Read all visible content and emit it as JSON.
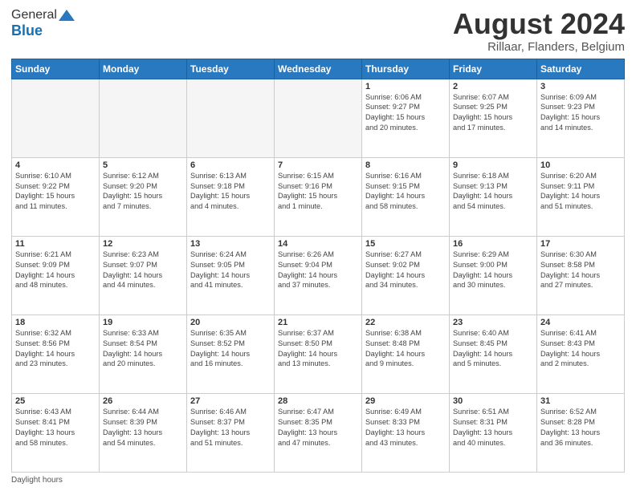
{
  "header": {
    "logo_general": "General",
    "logo_blue": "Blue",
    "month_title": "August 2024",
    "location": "Rillaar, Flanders, Belgium"
  },
  "days_of_week": [
    "Sunday",
    "Monday",
    "Tuesday",
    "Wednesday",
    "Thursday",
    "Friday",
    "Saturday"
  ],
  "footer": {
    "daylight_label": "Daylight hours"
  },
  "weeks": [
    [
      {
        "day": "",
        "info": ""
      },
      {
        "day": "",
        "info": ""
      },
      {
        "day": "",
        "info": ""
      },
      {
        "day": "",
        "info": ""
      },
      {
        "day": "1",
        "info": "Sunrise: 6:06 AM\nSunset: 9:27 PM\nDaylight: 15 hours\nand 20 minutes."
      },
      {
        "day": "2",
        "info": "Sunrise: 6:07 AM\nSunset: 9:25 PM\nDaylight: 15 hours\nand 17 minutes."
      },
      {
        "day": "3",
        "info": "Sunrise: 6:09 AM\nSunset: 9:23 PM\nDaylight: 15 hours\nand 14 minutes."
      }
    ],
    [
      {
        "day": "4",
        "info": "Sunrise: 6:10 AM\nSunset: 9:22 PM\nDaylight: 15 hours\nand 11 minutes."
      },
      {
        "day": "5",
        "info": "Sunrise: 6:12 AM\nSunset: 9:20 PM\nDaylight: 15 hours\nand 7 minutes."
      },
      {
        "day": "6",
        "info": "Sunrise: 6:13 AM\nSunset: 9:18 PM\nDaylight: 15 hours\nand 4 minutes."
      },
      {
        "day": "7",
        "info": "Sunrise: 6:15 AM\nSunset: 9:16 PM\nDaylight: 15 hours\nand 1 minute."
      },
      {
        "day": "8",
        "info": "Sunrise: 6:16 AM\nSunset: 9:15 PM\nDaylight: 14 hours\nand 58 minutes."
      },
      {
        "day": "9",
        "info": "Sunrise: 6:18 AM\nSunset: 9:13 PM\nDaylight: 14 hours\nand 54 minutes."
      },
      {
        "day": "10",
        "info": "Sunrise: 6:20 AM\nSunset: 9:11 PM\nDaylight: 14 hours\nand 51 minutes."
      }
    ],
    [
      {
        "day": "11",
        "info": "Sunrise: 6:21 AM\nSunset: 9:09 PM\nDaylight: 14 hours\nand 48 minutes."
      },
      {
        "day": "12",
        "info": "Sunrise: 6:23 AM\nSunset: 9:07 PM\nDaylight: 14 hours\nand 44 minutes."
      },
      {
        "day": "13",
        "info": "Sunrise: 6:24 AM\nSunset: 9:05 PM\nDaylight: 14 hours\nand 41 minutes."
      },
      {
        "day": "14",
        "info": "Sunrise: 6:26 AM\nSunset: 9:04 PM\nDaylight: 14 hours\nand 37 minutes."
      },
      {
        "day": "15",
        "info": "Sunrise: 6:27 AM\nSunset: 9:02 PM\nDaylight: 14 hours\nand 34 minutes."
      },
      {
        "day": "16",
        "info": "Sunrise: 6:29 AM\nSunset: 9:00 PM\nDaylight: 14 hours\nand 30 minutes."
      },
      {
        "day": "17",
        "info": "Sunrise: 6:30 AM\nSunset: 8:58 PM\nDaylight: 14 hours\nand 27 minutes."
      }
    ],
    [
      {
        "day": "18",
        "info": "Sunrise: 6:32 AM\nSunset: 8:56 PM\nDaylight: 14 hours\nand 23 minutes."
      },
      {
        "day": "19",
        "info": "Sunrise: 6:33 AM\nSunset: 8:54 PM\nDaylight: 14 hours\nand 20 minutes."
      },
      {
        "day": "20",
        "info": "Sunrise: 6:35 AM\nSunset: 8:52 PM\nDaylight: 14 hours\nand 16 minutes."
      },
      {
        "day": "21",
        "info": "Sunrise: 6:37 AM\nSunset: 8:50 PM\nDaylight: 14 hours\nand 13 minutes."
      },
      {
        "day": "22",
        "info": "Sunrise: 6:38 AM\nSunset: 8:48 PM\nDaylight: 14 hours\nand 9 minutes."
      },
      {
        "day": "23",
        "info": "Sunrise: 6:40 AM\nSunset: 8:45 PM\nDaylight: 14 hours\nand 5 minutes."
      },
      {
        "day": "24",
        "info": "Sunrise: 6:41 AM\nSunset: 8:43 PM\nDaylight: 14 hours\nand 2 minutes."
      }
    ],
    [
      {
        "day": "25",
        "info": "Sunrise: 6:43 AM\nSunset: 8:41 PM\nDaylight: 13 hours\nand 58 minutes."
      },
      {
        "day": "26",
        "info": "Sunrise: 6:44 AM\nSunset: 8:39 PM\nDaylight: 13 hours\nand 54 minutes."
      },
      {
        "day": "27",
        "info": "Sunrise: 6:46 AM\nSunset: 8:37 PM\nDaylight: 13 hours\nand 51 minutes."
      },
      {
        "day": "28",
        "info": "Sunrise: 6:47 AM\nSunset: 8:35 PM\nDaylight: 13 hours\nand 47 minutes."
      },
      {
        "day": "29",
        "info": "Sunrise: 6:49 AM\nSunset: 8:33 PM\nDaylight: 13 hours\nand 43 minutes."
      },
      {
        "day": "30",
        "info": "Sunrise: 6:51 AM\nSunset: 8:31 PM\nDaylight: 13 hours\nand 40 minutes."
      },
      {
        "day": "31",
        "info": "Sunrise: 6:52 AM\nSunset: 8:28 PM\nDaylight: 13 hours\nand 36 minutes."
      }
    ]
  ]
}
